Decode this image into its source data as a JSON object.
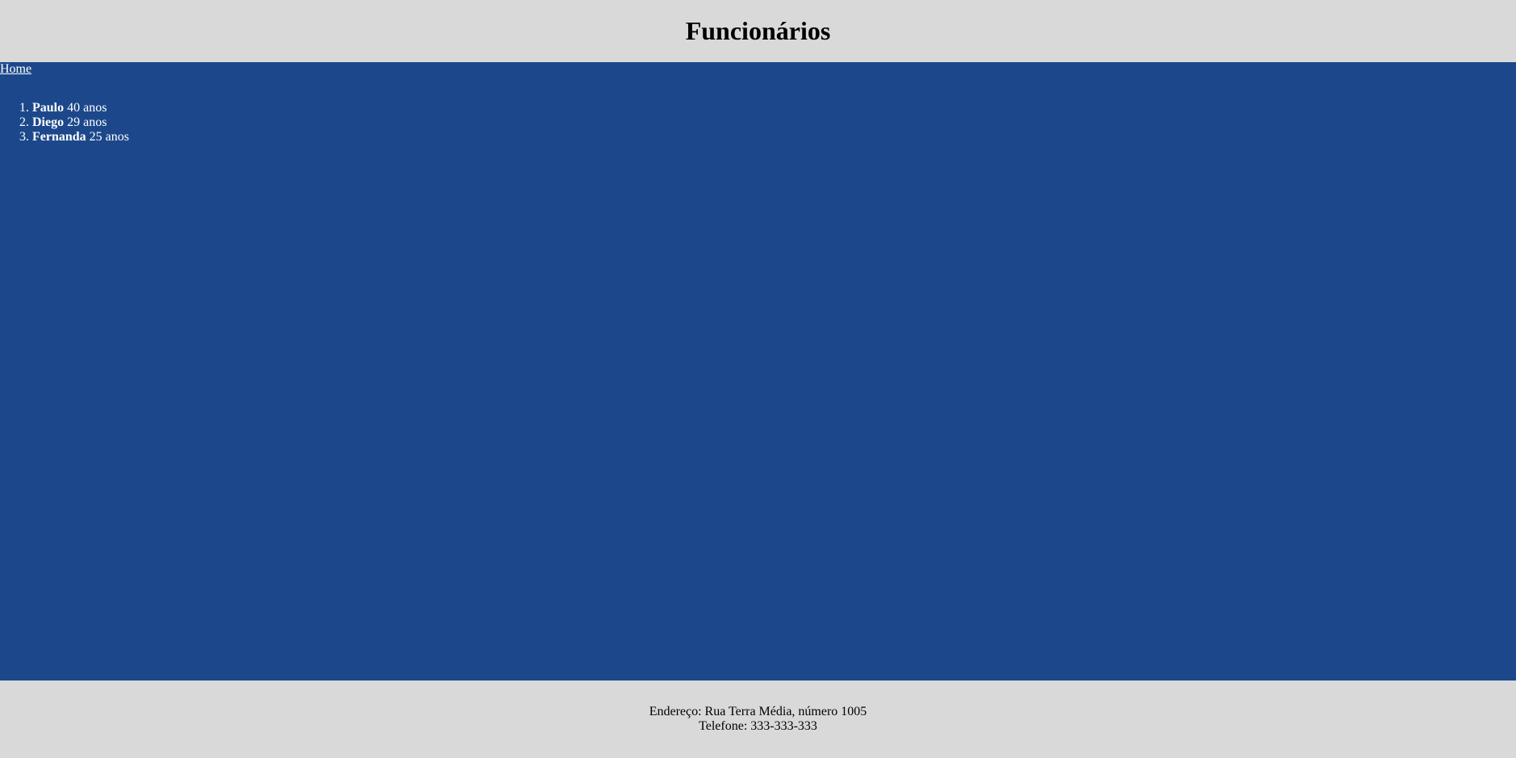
{
  "header": {
    "title": "Funcionários"
  },
  "nav": {
    "home_label": "Home"
  },
  "employees": [
    {
      "name": "Paulo",
      "age_text": "40 anos"
    },
    {
      "name": "Diego",
      "age_text": "29 anos"
    },
    {
      "name": "Fernanda",
      "age_text": "25 anos"
    }
  ],
  "footer": {
    "address": "Endereço: Rua Terra Média, número 1005",
    "phone": "Telefone: 333-333-333"
  },
  "colors": {
    "header_bg": "#d9d9d9",
    "main_bg": "#1c488b",
    "footer_bg": "#d9d9d9"
  }
}
